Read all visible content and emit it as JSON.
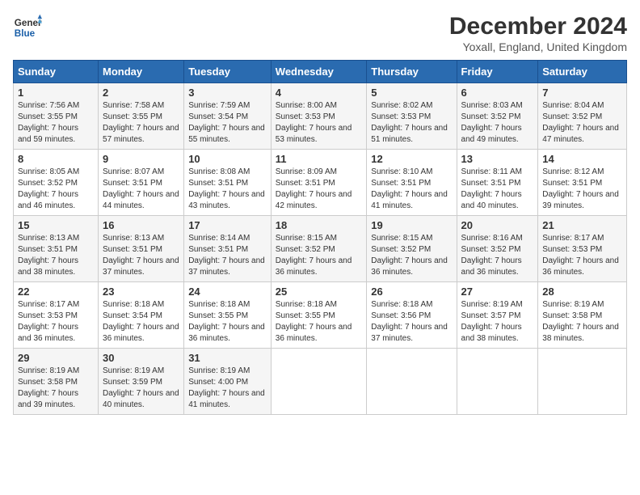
{
  "header": {
    "logo_line1": "General",
    "logo_line2": "Blue",
    "title": "December 2024",
    "subtitle": "Yoxall, England, United Kingdom"
  },
  "columns": [
    "Sunday",
    "Monday",
    "Tuesday",
    "Wednesday",
    "Thursday",
    "Friday",
    "Saturday"
  ],
  "weeks": [
    [
      {
        "day": 1,
        "sunrise": "7:56 AM",
        "sunset": "3:55 PM",
        "daylight": "7 hours and 59 minutes."
      },
      {
        "day": 2,
        "sunrise": "7:58 AM",
        "sunset": "3:55 PM",
        "daylight": "7 hours and 57 minutes."
      },
      {
        "day": 3,
        "sunrise": "7:59 AM",
        "sunset": "3:54 PM",
        "daylight": "7 hours and 55 minutes."
      },
      {
        "day": 4,
        "sunrise": "8:00 AM",
        "sunset": "3:53 PM",
        "daylight": "7 hours and 53 minutes."
      },
      {
        "day": 5,
        "sunrise": "8:02 AM",
        "sunset": "3:53 PM",
        "daylight": "7 hours and 51 minutes."
      },
      {
        "day": 6,
        "sunrise": "8:03 AM",
        "sunset": "3:52 PM",
        "daylight": "7 hours and 49 minutes."
      },
      {
        "day": 7,
        "sunrise": "8:04 AM",
        "sunset": "3:52 PM",
        "daylight": "7 hours and 47 minutes."
      }
    ],
    [
      {
        "day": 8,
        "sunrise": "8:05 AM",
        "sunset": "3:52 PM",
        "daylight": "7 hours and 46 minutes."
      },
      {
        "day": 9,
        "sunrise": "8:07 AM",
        "sunset": "3:51 PM",
        "daylight": "7 hours and 44 minutes."
      },
      {
        "day": 10,
        "sunrise": "8:08 AM",
        "sunset": "3:51 PM",
        "daylight": "7 hours and 43 minutes."
      },
      {
        "day": 11,
        "sunrise": "8:09 AM",
        "sunset": "3:51 PM",
        "daylight": "7 hours and 42 minutes."
      },
      {
        "day": 12,
        "sunrise": "8:10 AM",
        "sunset": "3:51 PM",
        "daylight": "7 hours and 41 minutes."
      },
      {
        "day": 13,
        "sunrise": "8:11 AM",
        "sunset": "3:51 PM",
        "daylight": "7 hours and 40 minutes."
      },
      {
        "day": 14,
        "sunrise": "8:12 AM",
        "sunset": "3:51 PM",
        "daylight": "7 hours and 39 minutes."
      }
    ],
    [
      {
        "day": 15,
        "sunrise": "8:13 AM",
        "sunset": "3:51 PM",
        "daylight": "7 hours and 38 minutes."
      },
      {
        "day": 16,
        "sunrise": "8:13 AM",
        "sunset": "3:51 PM",
        "daylight": "7 hours and 37 minutes."
      },
      {
        "day": 17,
        "sunrise": "8:14 AM",
        "sunset": "3:51 PM",
        "daylight": "7 hours and 37 minutes."
      },
      {
        "day": 18,
        "sunrise": "8:15 AM",
        "sunset": "3:52 PM",
        "daylight": "7 hours and 36 minutes."
      },
      {
        "day": 19,
        "sunrise": "8:15 AM",
        "sunset": "3:52 PM",
        "daylight": "7 hours and 36 minutes."
      },
      {
        "day": 20,
        "sunrise": "8:16 AM",
        "sunset": "3:52 PM",
        "daylight": "7 hours and 36 minutes."
      },
      {
        "day": 21,
        "sunrise": "8:17 AM",
        "sunset": "3:53 PM",
        "daylight": "7 hours and 36 minutes."
      }
    ],
    [
      {
        "day": 22,
        "sunrise": "8:17 AM",
        "sunset": "3:53 PM",
        "daylight": "7 hours and 36 minutes."
      },
      {
        "day": 23,
        "sunrise": "8:18 AM",
        "sunset": "3:54 PM",
        "daylight": "7 hours and 36 minutes."
      },
      {
        "day": 24,
        "sunrise": "8:18 AM",
        "sunset": "3:55 PM",
        "daylight": "7 hours and 36 minutes."
      },
      {
        "day": 25,
        "sunrise": "8:18 AM",
        "sunset": "3:55 PM",
        "daylight": "7 hours and 36 minutes."
      },
      {
        "day": 26,
        "sunrise": "8:18 AM",
        "sunset": "3:56 PM",
        "daylight": "7 hours and 37 minutes."
      },
      {
        "day": 27,
        "sunrise": "8:19 AM",
        "sunset": "3:57 PM",
        "daylight": "7 hours and 38 minutes."
      },
      {
        "day": 28,
        "sunrise": "8:19 AM",
        "sunset": "3:58 PM",
        "daylight": "7 hours and 38 minutes."
      }
    ],
    [
      {
        "day": 29,
        "sunrise": "8:19 AM",
        "sunset": "3:58 PM",
        "daylight": "7 hours and 39 minutes."
      },
      {
        "day": 30,
        "sunrise": "8:19 AM",
        "sunset": "3:59 PM",
        "daylight": "7 hours and 40 minutes."
      },
      {
        "day": 31,
        "sunrise": "8:19 AM",
        "sunset": "4:00 PM",
        "daylight": "7 hours and 41 minutes."
      },
      null,
      null,
      null,
      null
    ]
  ]
}
